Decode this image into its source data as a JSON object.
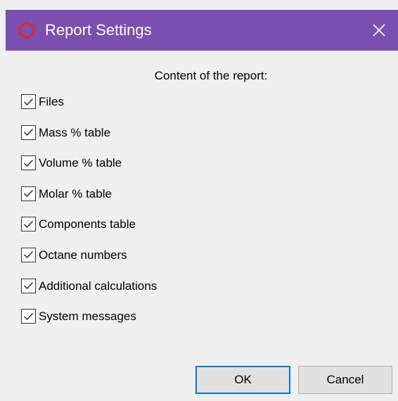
{
  "window": {
    "title": "Report Settings",
    "icon": "hexagon-logo-icon",
    "close_icon": "close-icon",
    "accent_color": "#7a4fb0",
    "logo_color": "#d42a3a"
  },
  "dialog": {
    "heading": "Content of the report:",
    "options": [
      {
        "label": "Files",
        "checked": true
      },
      {
        "label": "Mass % table",
        "checked": true
      },
      {
        "label": "Volume % table",
        "checked": true
      },
      {
        "label": "Molar % table",
        "checked": true
      },
      {
        "label": "Components table",
        "checked": true
      },
      {
        "label": "Octane numbers",
        "checked": true
      },
      {
        "label": "Additional calculations",
        "checked": true
      },
      {
        "label": "System messages",
        "checked": true
      }
    ]
  },
  "buttons": {
    "ok_label": "OK",
    "cancel_label": "Cancel",
    "focus_color": "#0078d7"
  }
}
